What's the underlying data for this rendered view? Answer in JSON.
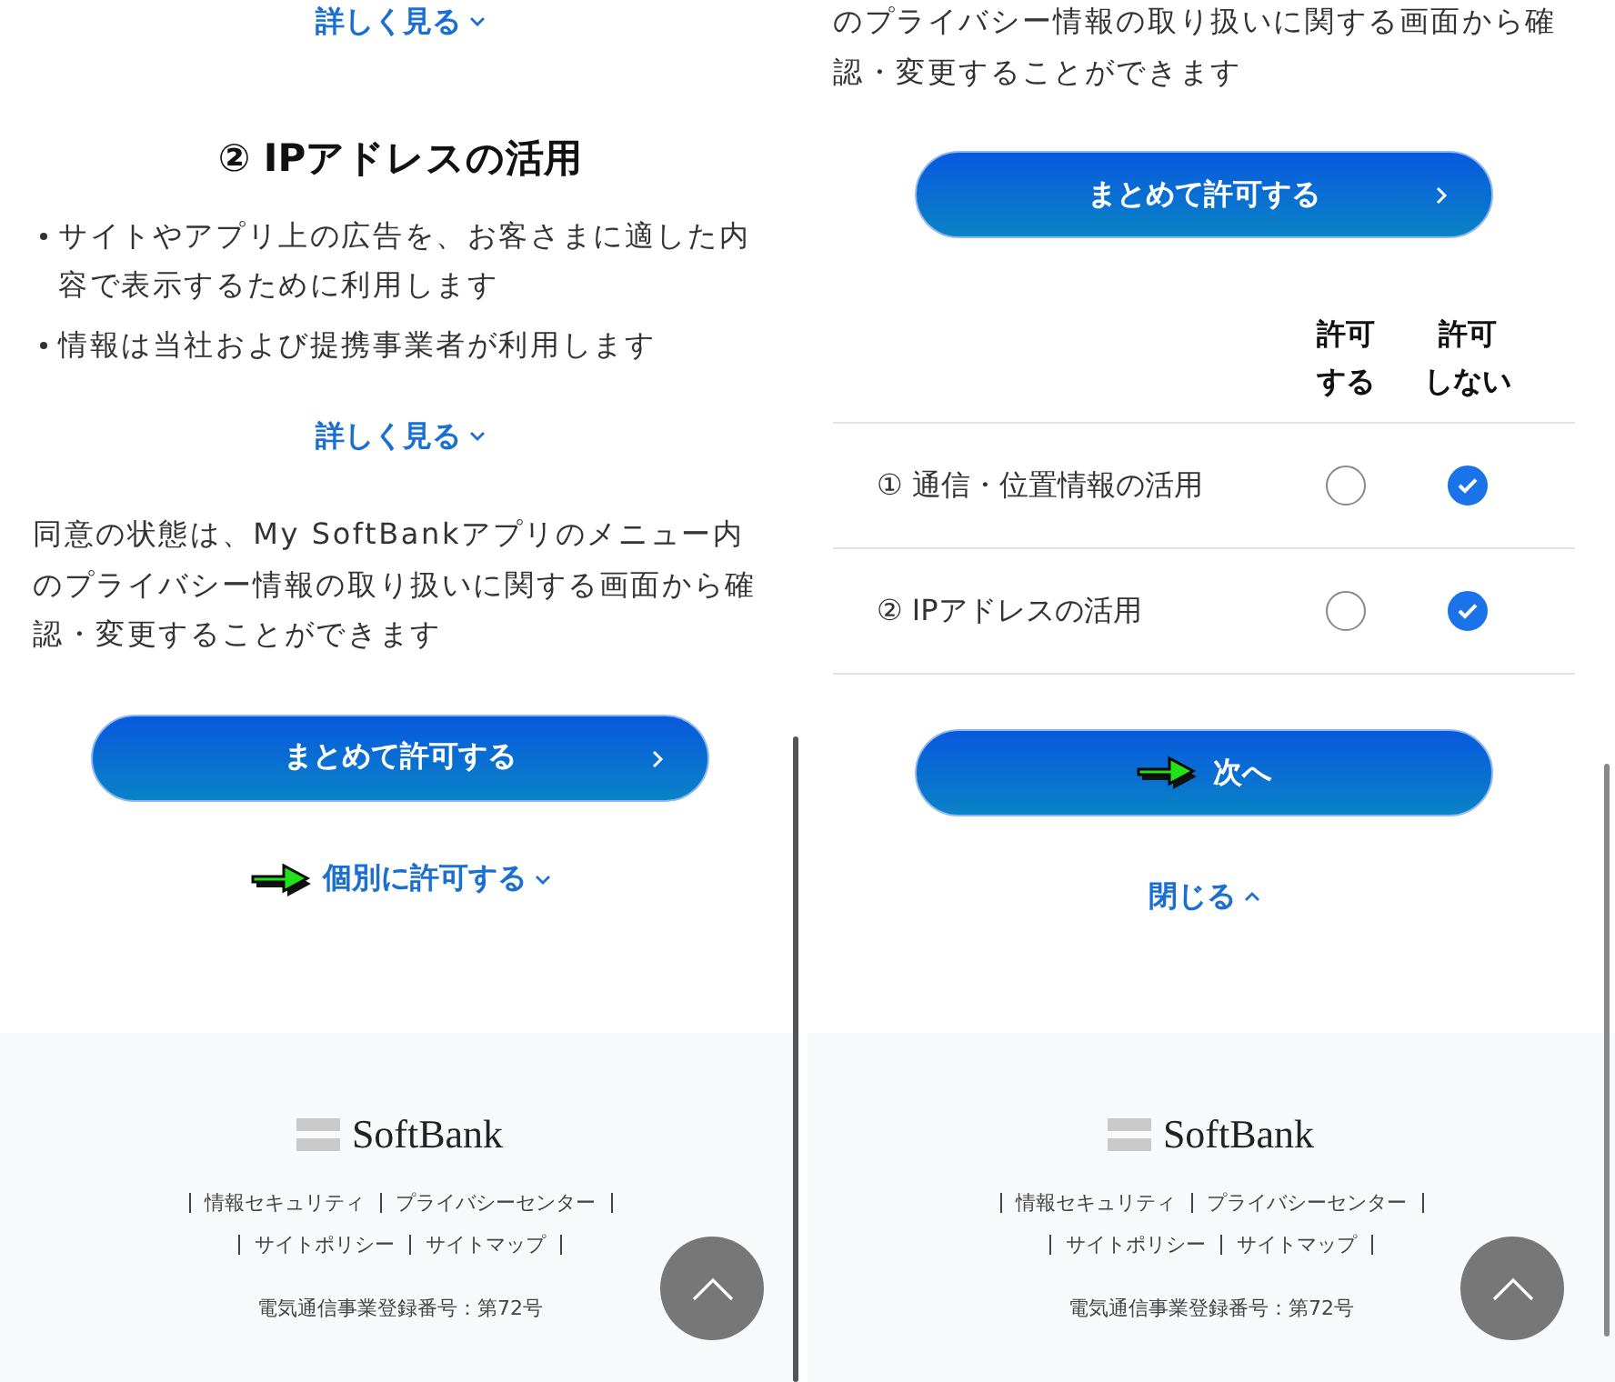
{
  "panes": [
    {
      "blocks": [
        {
          "kind": "link",
          "text": "詳しく見る",
          "expanded": false,
          "highlighted": false
        },
        {
          "kind": "heading",
          "text": "② IPアドレスの活用"
        },
        {
          "kind": "bullets",
          "items": [
            "サイトやアプリ上の広告を、お客さまに適した内容で表示するために利用します",
            "情報は当社および提携事業者が利用します"
          ]
        },
        {
          "kind": "link",
          "text": "詳しく見る",
          "expanded": false,
          "highlighted": false
        },
        {
          "kind": "paragraph",
          "text": "同意の状態は、My SoftBankアプリのメニュー内のプライバシー情報の取り扱いに関する画面から確認・変更することができます"
        },
        {
          "kind": "button",
          "text": "まとめて許可する",
          "chevron": true,
          "highlighted": false
        },
        {
          "kind": "link",
          "text": "個別に許可する",
          "expanded": false,
          "highlighted": true
        }
      ],
      "footer": {
        "logo": "SoftBank",
        "link_rows": [
          [
            "情報セキュリティ",
            "プライバシーセンター"
          ],
          [
            "サイトポリシー",
            "サイトマップ"
          ]
        ],
        "registration": "電気通信事業登録番号：第72号"
      }
    },
    {
      "blocks": [
        {
          "kind": "paragraph",
          "text": "のプライバシー情報の取り扱いに関する画面から確認・変更することができます"
        },
        {
          "kind": "button",
          "text": "まとめて許可する",
          "chevron": true,
          "highlighted": false
        },
        {
          "kind": "table",
          "columns": [
            [
              "許可",
              "する"
            ],
            [
              "許可",
              "しない"
            ]
          ],
          "rows": [
            {
              "label": "① 通信・位置情報の活用",
              "choices": [
                {
                  "selected": false
                },
                {
                  "selected": true
                }
              ]
            },
            {
              "label": "② IPアドレスの活用",
              "choices": [
                {
                  "selected": false
                },
                {
                  "selected": true
                }
              ]
            }
          ]
        },
        {
          "kind": "button",
          "text": "次へ",
          "chevron": false,
          "highlighted": true
        },
        {
          "kind": "link",
          "text": "閉じる",
          "expanded": true,
          "highlighted": false
        }
      ],
      "footer": {
        "logo": "SoftBank",
        "link_rows": [
          [
            "情報セキュリティ",
            "プライバシーセンター"
          ],
          [
            "サイトポリシー",
            "サイトマップ"
          ]
        ],
        "registration": "電気通信事業登録番号：第72号"
      }
    }
  ]
}
